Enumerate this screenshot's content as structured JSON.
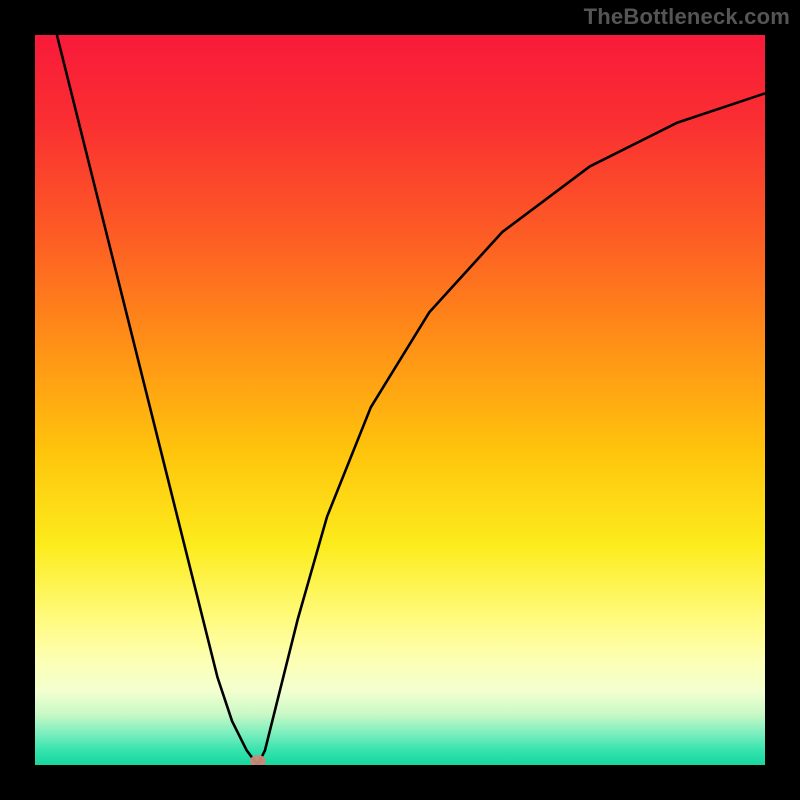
{
  "watermark": "TheBottleneck.com",
  "chart_data": {
    "type": "line",
    "title": "",
    "xlabel": "",
    "ylabel": "",
    "xlim": [
      0,
      100
    ],
    "ylim": [
      0,
      100
    ],
    "series": [
      {
        "name": "curve",
        "x": [
          3,
          6,
          10,
          14,
          18,
          22,
          25,
          27,
          29,
          30.5,
          31.5,
          33,
          36,
          40,
          46,
          54,
          64,
          76,
          88,
          100
        ],
        "values": [
          100,
          88,
          72,
          56,
          40,
          24,
          12,
          6,
          2,
          0,
          2,
          8,
          20,
          34,
          49,
          62,
          73,
          82,
          88,
          92
        ]
      }
    ],
    "marker": {
      "x": 30.5,
      "y": 0.5,
      "color": "#c98a7a"
    },
    "background": {
      "type": "heat-gradient",
      "stops": [
        {
          "pct": 0,
          "color": "#f81a3a"
        },
        {
          "pct": 40,
          "color": "#ff8f17"
        },
        {
          "pct": 70,
          "color": "#fcec1d"
        },
        {
          "pct": 90,
          "color": "#f2ffd0"
        },
        {
          "pct": 100,
          "color": "#17d79e"
        }
      ]
    }
  }
}
